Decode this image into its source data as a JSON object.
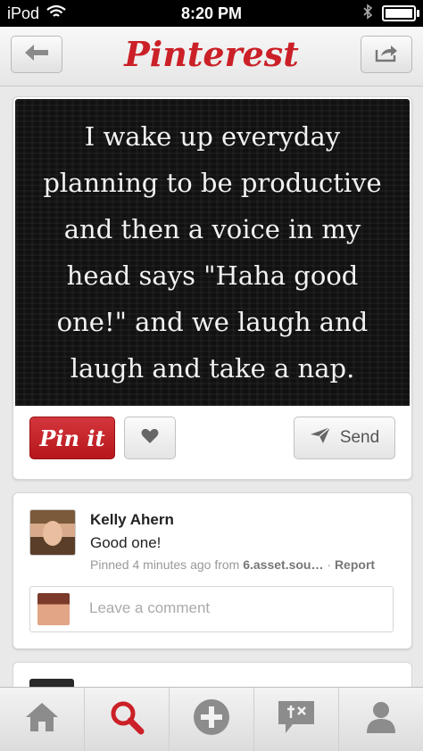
{
  "status_bar": {
    "carrier": "iPod",
    "time": "8:20 PM",
    "wifi_icon": "wifi-icon",
    "bluetooth_icon": "bluetooth-icon",
    "battery_icon": "battery-icon"
  },
  "navbar": {
    "title": "Pinterest",
    "back_icon": "back-arrow-icon",
    "share_icon": "share-icon"
  },
  "pin": {
    "quote": "I wake up everyday\nplanning to be productive\nand then a voice in my\nhead says \"Haha good\none!\" and we laugh and\nlaugh and take a nap.",
    "pinit_label": "Pin it",
    "like_icon": "heart-icon",
    "send_label": "Send",
    "send_icon": "send-icon"
  },
  "comment": {
    "author": "Kelly Ahern",
    "text": "Good one!",
    "meta_prefix": "Pinned 4 minutes ago from ",
    "source": "6.asset.sou…",
    "separator": " · ",
    "report_label": "Report",
    "input_placeholder": "Leave a comment"
  },
  "tabbar": {
    "items": [
      {
        "label": "home",
        "icon": "home-icon"
      },
      {
        "label": "search",
        "icon": "search-icon",
        "active": true
      },
      {
        "label": "add",
        "icon": "plus-icon"
      },
      {
        "label": "news",
        "icon": "news-icon"
      },
      {
        "label": "profile",
        "icon": "profile-icon"
      }
    ]
  },
  "colors": {
    "brand_red": "#cb2027",
    "background": "#e9e9e9",
    "search_active": "#cb2027"
  }
}
